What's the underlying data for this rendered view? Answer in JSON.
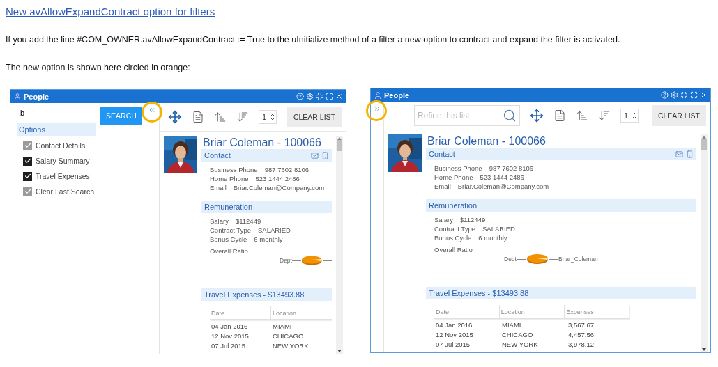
{
  "document": {
    "heading_link": "New avAllowExpandContract option for filters",
    "paragraphs": [
      "If you add the line #COM_OWNER.avAllowExpandContract := True to the uInitialize method of a filter a new option to contract and expand the filter is activated.",
      "The new option is shown here circled in orange:"
    ]
  },
  "screenshots": [
    {
      "window": {
        "title": "People"
      },
      "filter_expanded": true,
      "toggle_highlighted": true,
      "filter": {
        "search_value": "b",
        "search_button": "SEARCH",
        "options_header": "Options",
        "options": [
          {
            "label": "Contact Details",
            "checked": true,
            "disabled": true
          },
          {
            "label": "Salary Summary",
            "checked": true,
            "disabled": false
          },
          {
            "label": "Travel Expenses",
            "checked": true,
            "disabled": false
          },
          {
            "label": "Clear Last Search",
            "checked": true,
            "disabled": true
          }
        ]
      },
      "toolbar": {
        "page_value": "1",
        "clear_button": "CLEAR LIST"
      },
      "record": {
        "name": "Briar Coleman - 100066",
        "contact": {
          "header": "Contact",
          "fields": [
            {
              "label": "Business Phone",
              "value": "987 7602 8106"
            },
            {
              "label": "Home Phone",
              "value": "523 1444 2486"
            },
            {
              "label": "Email",
              "value": "Briar.Coleman@Company.com"
            }
          ]
        },
        "remuneration": {
          "header": "Remuneration",
          "fields": [
            {
              "label": "Salary",
              "value": "$112449"
            },
            {
              "label": "Contract Type",
              "value": "SALARIED"
            },
            {
              "label": "Bonus Cycle",
              "value": "6 monthly"
            }
          ],
          "ratio_label": "Overall Ratio",
          "pie_labels": [
            "Dept"
          ]
        },
        "travel": {
          "header": "Travel Expenses - $13493.88",
          "columns": [
            "Date",
            "Location"
          ],
          "rows": [
            [
              "04 Jan 2016",
              "MIAMI"
            ],
            [
              "12 Nov 2015",
              "CHICAGO"
            ],
            [
              "07 Jul 2015",
              "NEW YORK"
            ]
          ]
        }
      }
    },
    {
      "window": {
        "title": "People"
      },
      "filter_expanded": false,
      "toggle_highlighted": true,
      "toolbar": {
        "search_placeholder": "Refine this list",
        "page_value": "1",
        "clear_button": "CLEAR LIST"
      },
      "record": {
        "name": "Briar Coleman - 100066",
        "contact": {
          "header": "Contact",
          "fields": [
            {
              "label": "Business Phone",
              "value": "987 7602 8106"
            },
            {
              "label": "Home Phone",
              "value": "523 1444 2486"
            },
            {
              "label": "Email",
              "value": "Briar.Coleman@Company.com"
            }
          ]
        },
        "remuneration": {
          "header": "Remuneration",
          "fields": [
            {
              "label": "Salary",
              "value": "$112449"
            },
            {
              "label": "Contract Type",
              "value": "SALARIED"
            },
            {
              "label": "Bonus Cycle",
              "value": "6 monthly"
            }
          ],
          "ratio_label": "Overall Ratio",
          "pie_labels": [
            "Dept",
            "Briar_Coleman"
          ]
        },
        "travel": {
          "header": "Travel Expenses - $13493.88",
          "columns": [
            "Date",
            "Location",
            "Expenses"
          ],
          "rows": [
            [
              "04 Jan 2016",
              "MIAMI",
              "3,567.67"
            ],
            [
              "12 Nov 2015",
              "CHICAGO",
              "4,457.56"
            ],
            [
              "07 Jul 2015",
              "NEW YORK",
              "3,978.12"
            ]
          ]
        }
      }
    }
  ]
}
